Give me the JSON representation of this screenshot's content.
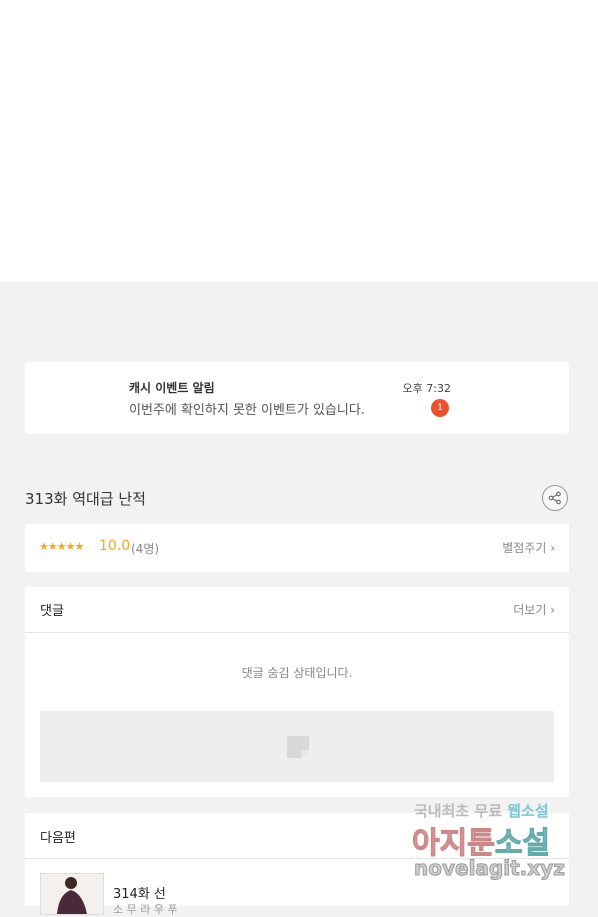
{
  "notice": {
    "title": "캐시 이벤트 알림",
    "time": "오후 7:32",
    "body": "이번주에 확인하지 못한 이벤트가 있습니다.",
    "badge": "1"
  },
  "episode": {
    "title": "313화 역대급 난적"
  },
  "rating": {
    "stars": "★★★★★",
    "score": "10.0",
    "count": "(4명)",
    "rate_label": "별점주기 ›"
  },
  "comments": {
    "title": "댓글",
    "more_label": "더보기 ›",
    "hidden_message": "댓글 숨김 상태입니다."
  },
  "next": {
    "title": "다음편",
    "episode_title": "314화 선",
    "episode_sub": "소 무 라 우 푸"
  },
  "watermark": {
    "line1_a": "국내최초 무료 ",
    "line1_b": "웹소설",
    "line2_a": "아지툰",
    "line2_b": "소설",
    "line3": "novelagit.xyz"
  },
  "colors": {
    "accent_star": "#f5a623",
    "badge": "#e8532e",
    "background": "#f2f2f2"
  }
}
